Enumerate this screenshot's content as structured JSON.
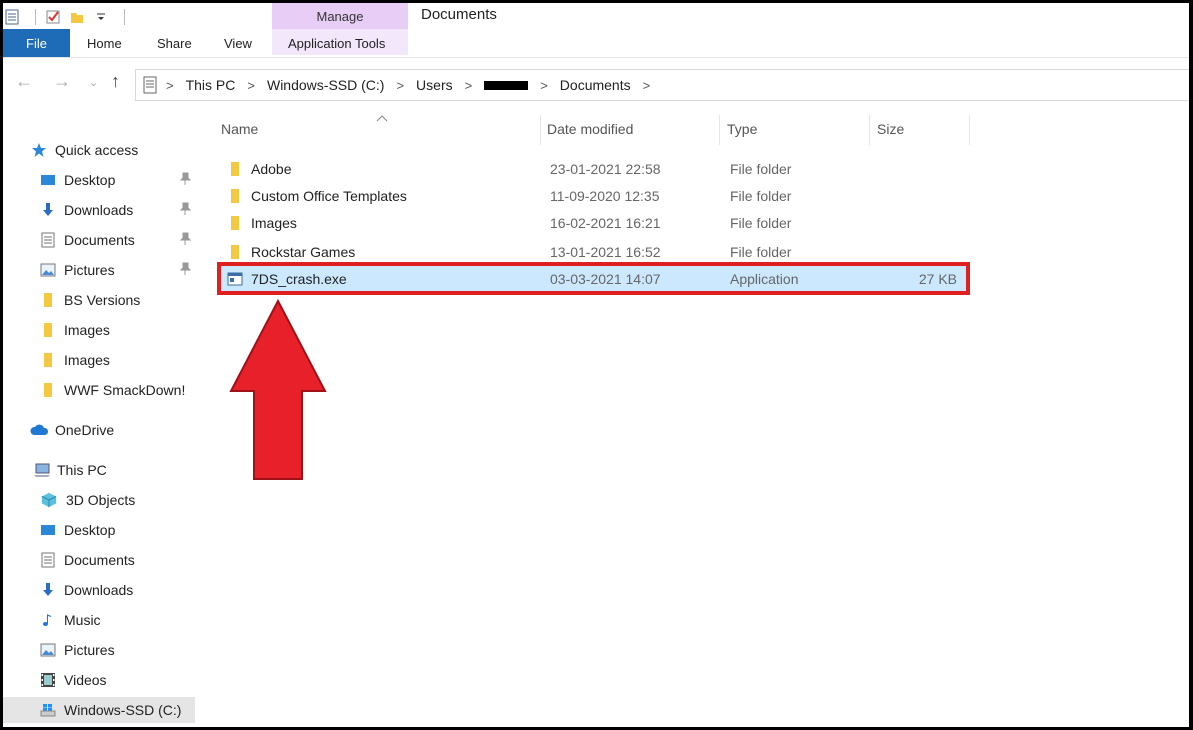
{
  "window": {
    "title": "Documents"
  },
  "ribbon": {
    "tabs": {
      "file": "File",
      "home": "Home",
      "share": "Share",
      "view": "View"
    },
    "context": {
      "header": "Manage",
      "tab": "Application Tools"
    }
  },
  "address": {
    "crumbs": [
      "This PC",
      "Windows-SSD (C:)",
      "Users",
      "Documents"
    ]
  },
  "nav": {
    "quick_access": "Quick access",
    "qa_items": [
      "Desktop",
      "Downloads",
      "Documents",
      "Pictures",
      "BS Versions",
      "Images",
      "Images",
      "WWF SmackDown!"
    ],
    "onedrive": "OneDrive",
    "this_pc": "This PC",
    "pc_items": [
      "3D Objects",
      "Desktop",
      "Documents",
      "Downloads",
      "Music",
      "Pictures",
      "Videos",
      "Windows-SSD (C:)"
    ]
  },
  "columns": {
    "name": "Name",
    "date": "Date modified",
    "type": "Type",
    "size": "Size"
  },
  "files": [
    {
      "name": "Adobe",
      "date": "23-01-2021 22:58",
      "type": "File folder",
      "size": ""
    },
    {
      "name": "Custom Office Templates",
      "date": "11-09-2020 12:35",
      "type": "File folder",
      "size": ""
    },
    {
      "name": "Images",
      "date": "16-02-2021 16:21",
      "type": "File folder",
      "size": ""
    },
    {
      "name": "Rockstar Games",
      "date": "13-01-2021 16:52",
      "type": "File folder",
      "size": ""
    },
    {
      "name": "7DS_crash.exe",
      "date": "03-03-2021 14:07",
      "type": "Application",
      "size": "27 KB"
    }
  ],
  "colors": {
    "file_tab": "#1e6bb8",
    "manage_ctx": "#e8cdf7",
    "selection": "#cce8ff",
    "annotation": "#e02020"
  }
}
